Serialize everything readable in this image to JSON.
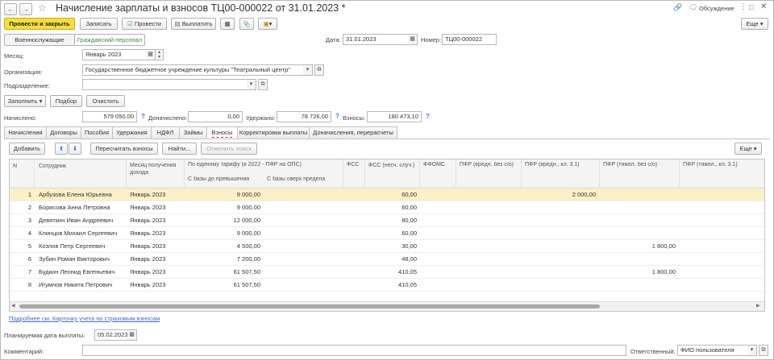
{
  "window": {
    "title": "Начисление зарплаты и взносов ТЦ00-000022 от 31.01.2023 *",
    "discussion_label": "Обсуждение"
  },
  "toolbar": {
    "post_close": "Провести и закрыть",
    "save": "Записать",
    "post": "Провести",
    "pay": "Выплатить",
    "more": "Еще"
  },
  "category_toggle": [
    "Военнослужащие",
    "Гражданский персонал"
  ],
  "header": {
    "date_label": "Дата:",
    "date_value": "31.01.2023",
    "number_label": "Номер:",
    "number_value": "ТЦ00-000022",
    "month_label": "Месяц:",
    "month_value": "Январь 2023",
    "org_label": "Организация:",
    "org_value": "Государственное бюджетное учреждение культуры \"Театральный центр\"",
    "dept_label": "Подразделение:",
    "dept_value": ""
  },
  "actions": {
    "fill": "Заполнить",
    "select": "Подбор",
    "clear": "Очистить"
  },
  "totals": {
    "accrued_label": "Начислено:",
    "accrued_value": "579 050,00",
    "extra_label": "Доначислено:",
    "extra_value": "0,00",
    "withheld_label": "Удержано:",
    "withheld_value": "78 726,00",
    "contrib_label": "Взносы:",
    "contrib_value": "180 473,10",
    "help": "?"
  },
  "tabs": [
    "Начисления",
    "Договоры",
    "Пособия",
    "Удержания",
    "НДФЛ",
    "Займы",
    "Взносы",
    "Корректировки выплаты",
    "Доначисления, перерасчеты"
  ],
  "tab_toolbar": {
    "add": "Добавить",
    "recalc": "Пересчитать взносы",
    "find": "Найти...",
    "cancel_search": "Отменить поиск",
    "more": "Еще"
  },
  "grid": {
    "headers": {
      "n": "N",
      "employee": "Сотрудник",
      "month": "Месяц получения дохода",
      "single_tariff": "По единому тарифу (в 2022 - ПФР на ОПС)",
      "base_above": "С базы до превышения",
      "base_over": "С базы сверх предела",
      "fss": "ФСС",
      "fss_accident": "ФСС (несч. случ.)",
      "ffoms": "ФФОМС",
      "pfr_harm": "ПФР (вредн. без с/о)",
      "pfr_harm_cl": "ПФР (вредн., кл. 3.1)",
      "pfr_heavy": "ПФР (тяжел. без с/о)",
      "pfr_heavy_cl": "ПФР (тяжел., кл. 3.1)"
    },
    "rows": [
      {
        "n": "1",
        "employee": "Арбузова Елена Юрьевна",
        "month": "Январь 2023",
        "base": "9 000,00",
        "fss_acc": "60,00",
        "pfr_harm_cl": "2 000,00",
        "pfr_heavy": ""
      },
      {
        "n": "2",
        "employee": "Борисова Анна Петровна",
        "month": "Январь 2023",
        "base": "9 000,00",
        "fss_acc": "60,00",
        "pfr_harm_cl": "",
        "pfr_heavy": ""
      },
      {
        "n": "3",
        "employee": "Девяткин Иван Андреевич",
        "month": "Январь 2023",
        "base": "12 000,00",
        "fss_acc": "80,00",
        "pfr_harm_cl": "",
        "pfr_heavy": ""
      },
      {
        "n": "4",
        "employee": "Клинцов Михаил Сергеевич",
        "month": "Январь 2023",
        "base": "9 000,00",
        "fss_acc": "60,00",
        "pfr_harm_cl": "",
        "pfr_heavy": ""
      },
      {
        "n": "5",
        "employee": "Козлов Петр Сергеевич",
        "month": "Январь 2023",
        "base": "4 500,00",
        "fss_acc": "30,00",
        "pfr_harm_cl": "",
        "pfr_heavy": "1 800,00"
      },
      {
        "n": "6",
        "employee": "Зубин Роман Викторович",
        "month": "Январь 2023",
        "base": "7 200,00",
        "fss_acc": "48,00",
        "pfr_harm_cl": "",
        "pfr_heavy": ""
      },
      {
        "n": "7",
        "employee": "Будкин Леонид Евгеньевич",
        "month": "Январь 2023",
        "base": "61 507,50",
        "fss_acc": "410,05",
        "pfr_harm_cl": "",
        "pfr_heavy": "1 800,00"
      },
      {
        "n": "8",
        "employee": "Игумнов Никита Петрович",
        "month": "Январь 2023",
        "base": "61 507,50",
        "fss_acc": "410,05",
        "pfr_harm_cl": "",
        "pfr_heavy": ""
      }
    ]
  },
  "footer": {
    "details_link": "Подробнее см. Карточку учета по страховым взносам",
    "pay_date_label": "Планируемая дата выплаты:",
    "pay_date_value": "05.02.2023",
    "comment_label": "Комментарий:",
    "comment_value": "",
    "responsible_label": "Ответственный:",
    "responsible_value": "ФИО пользователя"
  }
}
